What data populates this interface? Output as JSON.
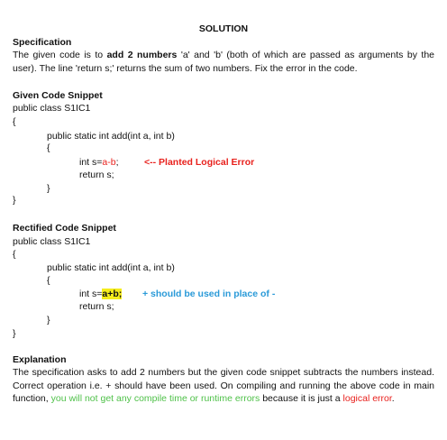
{
  "title": "SOLUTION",
  "specification": {
    "heading": "Specification",
    "text_1": "The given code is to ",
    "text_bold": "add 2 numbers",
    "text_2": " 'a' and 'b' (both of which are passed as arguments by the user). The line 'return s;' returns the sum of two numbers. Fix the error in the code."
  },
  "given": {
    "heading": "Given Code Snippet",
    "class_line": "public class S1IC1",
    "open_brace": "{",
    "method_line": "public static int add(int a, int b)",
    "method_open": "{",
    "stmt_prefix": "int s=",
    "stmt_expr": "a-b",
    "stmt_suffix": ";",
    "annotation": "<-- Planted Logical Error",
    "return_line": "return s;",
    "method_close": "}",
    "close_brace": "}"
  },
  "rectified": {
    "heading": "Rectified Code Snippet",
    "class_line": "public class S1IC1",
    "open_brace": "{",
    "method_line": "public static int add(int a, int b)",
    "method_open": "{",
    "stmt_prefix": "int s=",
    "stmt_expr": "a+b;",
    "annotation": "+ should be used in place of -",
    "return_line": "return s;",
    "method_close": "}",
    "close_brace": "}"
  },
  "explanation": {
    "heading": "Explanation",
    "text_1": "The specification asks to add 2 numbers but the given code snippet subtracts the numbers instead. Correct operation i.e. + should have been used. On compiling and running the above code in main function, ",
    "text_green": "you will not get any compile time or runtime errors",
    "text_2": " because it is just a ",
    "text_red": "logical error",
    "text_3": "."
  },
  "colors": {
    "error_red": "#e8211d",
    "fix_blue": "#2a9ad8",
    "note_green": "#4fc149",
    "highlight_yellow": "#f5ec1b"
  }
}
